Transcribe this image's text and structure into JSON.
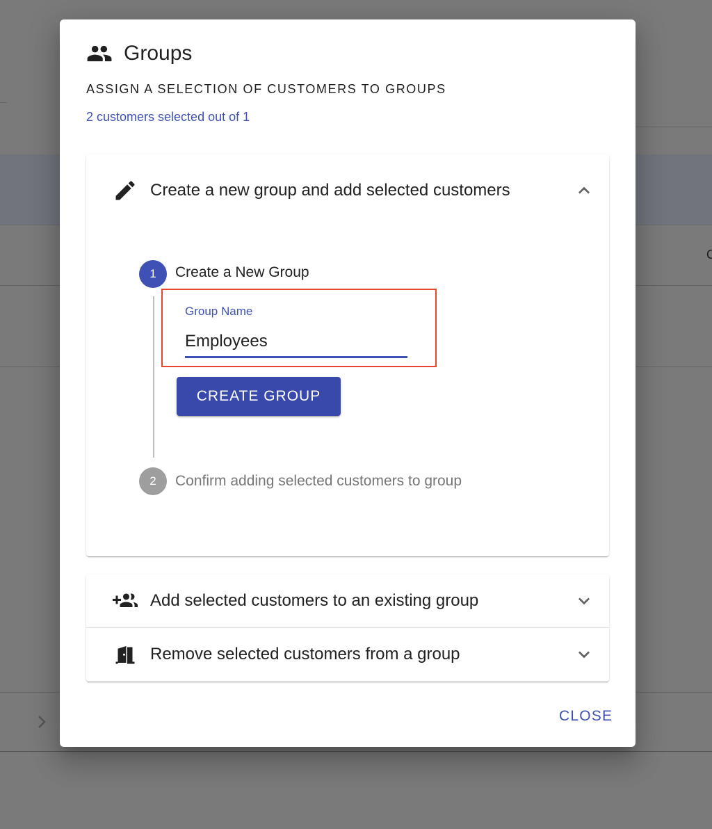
{
  "dialog": {
    "icon": "people-icon",
    "title": "Groups",
    "subtitle": "ASSIGN A SELECTION OF CUSTOMERS TO GROUPS",
    "selection_info": "2 customers selected out of 1",
    "close_label": "CLOSE"
  },
  "panels": [
    {
      "icon": "pencil-icon",
      "label": "Create a new group and add selected customers",
      "expanded": true,
      "expand_icon": "chevron-up-icon"
    },
    {
      "icon": "person-add-icon",
      "label": "Add selected customers to an existing group",
      "expanded": false,
      "expand_icon": "chevron-down-icon"
    },
    {
      "icon": "door-exit-icon",
      "label": "Remove selected customers from a group",
      "expanded": false,
      "expand_icon": "chevron-down-icon"
    }
  ],
  "stepper": {
    "steps": [
      {
        "number": "1",
        "label": "Create a New Group",
        "active": true
      },
      {
        "number": "2",
        "label": "Confirm adding selected customers to group",
        "active": false
      }
    ],
    "group_name_field": {
      "label": "Group Name",
      "value": "Employees"
    },
    "create_button_label": "CREATE GROUP"
  },
  "background": {
    "edge_text": "C"
  },
  "colors": {
    "primary": "#3f51b5",
    "button": "#3949ab",
    "highlight": "#e8452c",
    "inactive_step": "#9e9e9e",
    "overlay": "#7a7a7a"
  }
}
